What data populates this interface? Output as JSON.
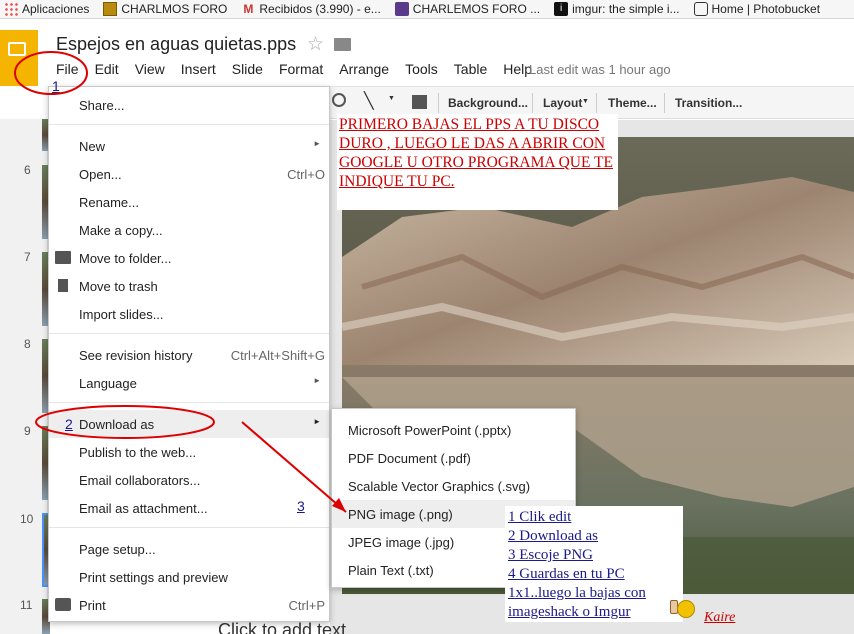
{
  "bookmarks": [
    {
      "label": "Aplicaciones",
      "icon": "apps-grid-icon"
    },
    {
      "label": "CHARLMOS FORO",
      "icon": "bookmark-icon"
    },
    {
      "label": "Recibidos (3.990) - e...",
      "icon": "gmail-icon"
    },
    {
      "label": "CHARLEMOS FORO ...",
      "icon": "bookmark-icon"
    },
    {
      "label": "imgur: the simple i...",
      "icon": "imgur-icon"
    },
    {
      "label": "Home | Photobucket",
      "icon": "camera-icon"
    }
  ],
  "document": {
    "title": "Espejos en aguas quietas.pps",
    "last_edit": "Last edit was 1 hour ago"
  },
  "menubar": [
    "File",
    "Edit",
    "View",
    "Insert",
    "Slide",
    "Format",
    "Arrange",
    "Tools",
    "Table",
    "Help"
  ],
  "toolbar": {
    "background": "Background...",
    "layout": "Layout",
    "theme": "Theme...",
    "transition": "Transition..."
  },
  "slides": [
    "6",
    "7",
    "8",
    "9",
    "10",
    "11"
  ],
  "file_menu": {
    "share": "Share...",
    "new": "New",
    "open": "Open...",
    "open_sc": "Ctrl+O",
    "rename": "Rename...",
    "copy": "Make a copy...",
    "move": "Move to folder...",
    "trash": "Move to trash",
    "import": "Import slides...",
    "revision": "See revision history",
    "revision_sc": "Ctrl+Alt+Shift+G",
    "language": "Language",
    "download": "Download as",
    "publish": "Publish to the web...",
    "email_collab": "Email collaborators...",
    "email_attach": "Email as attachment...",
    "page_setup": "Page setup...",
    "print_settings": "Print settings and preview",
    "print": "Print",
    "print_sc": "Ctrl+P"
  },
  "download_submenu": [
    "Microsoft PowerPoint (.pptx)",
    "PDF Document (.pdf)",
    "Scalable Vector Graphics (.svg)",
    "PNG image (.png)",
    "JPEG image (.jpg)",
    "Plain Text (.txt)"
  ],
  "annotations": {
    "top_note": "PRIMERO BAJAS EL PPS A TU DISCO DURO , LUEGO LE DAS A ABRIR CON GOOGLE U OTRO PROGRAMA QUE TE INDIQUE TU PC.",
    "steps": [
      "1 Clik edit",
      "2 Download as",
      "3 Escoje PNG",
      "4 Guardas en tu PC",
      "1x1..luego la bajas con imageshack o Imgur"
    ],
    "author": "Kaire",
    "step_numbers": [
      "1",
      "2",
      "3"
    ]
  },
  "canvas": {
    "placeholder": "Click to add text"
  },
  "colors": {
    "accent": "#f4b400",
    "annotation_red": "#cc0000",
    "annotation_blue": "#1a1a8a"
  }
}
